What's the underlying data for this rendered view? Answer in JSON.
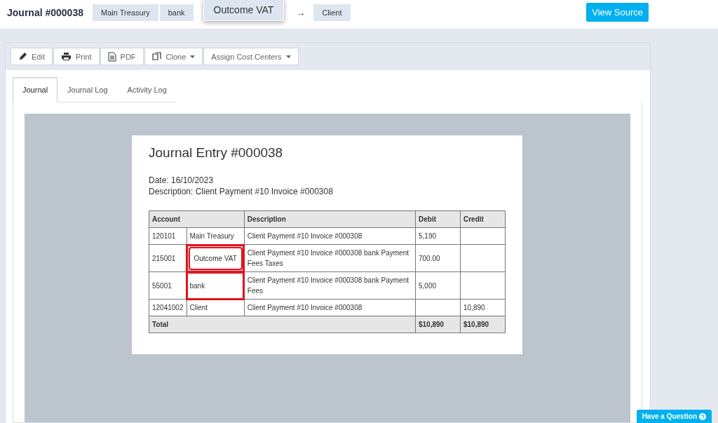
{
  "header": {
    "title": "Journal #000038",
    "chips": [
      {
        "label": "Main Treasury",
        "popup": false
      },
      {
        "label": "bank",
        "popup": false
      },
      {
        "label": "Outcome VAT",
        "popup": true
      }
    ],
    "arrow": "→",
    "target": "Client",
    "view_source": "View Source"
  },
  "toolbar": [
    {
      "label": "Edit",
      "kind": "edit",
      "dropdown": false
    },
    {
      "label": "Print",
      "kind": "print",
      "dropdown": false
    },
    {
      "label": "PDF",
      "kind": "pdf",
      "dropdown": false
    },
    {
      "label": "Clone",
      "kind": "clone",
      "dropdown": true
    },
    {
      "label": "Assign Cost Centers",
      "kind": "assign",
      "dropdown": true
    }
  ],
  "tabs": [
    {
      "label": "Journal",
      "selected": true
    },
    {
      "label": "Journal Log",
      "selected": false
    },
    {
      "label": "Activity Log",
      "selected": false
    }
  ],
  "document": {
    "title": "Journal Entry #000038",
    "date": "Date: 16/10/2023",
    "description": "Description: Client Payment #10  Invoice #000308",
    "columns": [
      "Account",
      "Description",
      "Debit",
      "Credit"
    ],
    "rows": [
      {
        "code": "120101",
        "name": "Main Treasury",
        "description": "Client Payment #10  Invoice #000308",
        "debit": "5,190",
        "credit": "",
        "highlighted": false,
        "popup": false
      },
      {
        "code": "215001",
        "name": "Outcome VAT",
        "description": "Client Payment #10  Invoice #000308 bank Payment Fees Taxes",
        "debit": "700.00",
        "credit": "",
        "highlighted": true,
        "popup": true
      },
      {
        "code": "55001",
        "name": "bank",
        "description": "Client Payment #10  Invoice #000308 bank Payment Fees",
        "debit": "5,000",
        "credit": "",
        "highlighted": true,
        "popup": false
      },
      {
        "code": "12041002",
        "name": "Client",
        "description": "Client Payment #10 Invoice #000308",
        "debit": "",
        "credit": "10,890",
        "highlighted": false,
        "popup": false
      }
    ],
    "total": {
      "label": "Total",
      "debit": "$10,890",
      "credit": "$10,890"
    }
  },
  "help_button": "Have a Question"
}
